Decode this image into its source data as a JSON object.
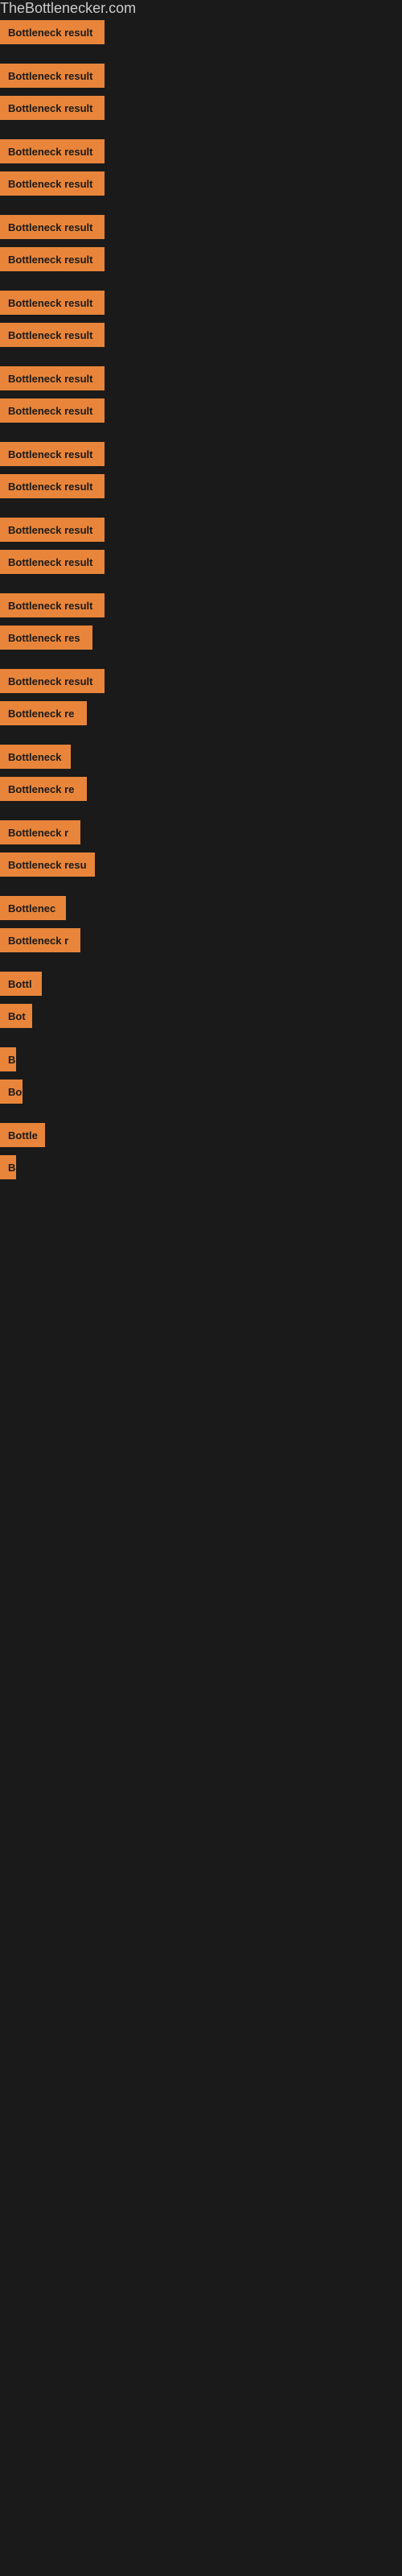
{
  "site": {
    "title": "TheBottlenecker.com"
  },
  "bars": [
    {
      "label": "Bottleneck result",
      "width": 130,
      "ext": 0
    },
    {
      "label": "Bottleneck result",
      "width": 130,
      "ext": 0
    },
    {
      "label": "Bottleneck result",
      "width": 130,
      "ext": 0
    },
    {
      "label": "Bottleneck result",
      "width": 130,
      "ext": 0
    },
    {
      "label": "Bottleneck result",
      "width": 130,
      "ext": 0
    },
    {
      "label": "Bottleneck result",
      "width": 130,
      "ext": 0
    },
    {
      "label": "Bottleneck result",
      "width": 130,
      "ext": 0
    },
    {
      "label": "Bottleneck result",
      "width": 130,
      "ext": 0
    },
    {
      "label": "Bottleneck result",
      "width": 130,
      "ext": 0
    },
    {
      "label": "Bottleneck result",
      "width": 130,
      "ext": 0
    },
    {
      "label": "Bottleneck result",
      "width": 130,
      "ext": 0
    },
    {
      "label": "Bottleneck result",
      "width": 130,
      "ext": 0
    },
    {
      "label": "Bottleneck result",
      "width": 130,
      "ext": 0
    },
    {
      "label": "Bottleneck result",
      "width": 130,
      "ext": 0
    },
    {
      "label": "Bottleneck result",
      "width": 130,
      "ext": 0
    },
    {
      "label": "Bottleneck result",
      "width": 130,
      "ext": 0
    },
    {
      "label": "Bottleneck res",
      "width": 115,
      "ext": 0
    },
    {
      "label": "Bottleneck result",
      "width": 130,
      "ext": 0
    },
    {
      "label": "Bottleneck re",
      "width": 108,
      "ext": 0
    },
    {
      "label": "Bottleneck",
      "width": 88,
      "ext": 0
    },
    {
      "label": "Bottleneck re",
      "width": 108,
      "ext": 0
    },
    {
      "label": "Bottleneck r",
      "width": 100,
      "ext": 0
    },
    {
      "label": "Bottleneck resu",
      "width": 118,
      "ext": 0
    },
    {
      "label": "Bottlenec",
      "width": 82,
      "ext": 0
    },
    {
      "label": "Bottleneck r",
      "width": 100,
      "ext": 0
    },
    {
      "label": "Bottl",
      "width": 52,
      "ext": 0
    },
    {
      "label": "Bot",
      "width": 40,
      "ext": 0
    },
    {
      "label": "B",
      "width": 18,
      "ext": 0
    },
    {
      "label": "Bo",
      "width": 28,
      "ext": 0
    },
    {
      "label": "Bottle",
      "width": 56,
      "ext": 0
    },
    {
      "label": "B",
      "width": 18,
      "ext": 0
    }
  ],
  "gaps": [
    0,
    1,
    3,
    5,
    7,
    9,
    11,
    13,
    15,
    17,
    19,
    21,
    23,
    25,
    27,
    29
  ]
}
